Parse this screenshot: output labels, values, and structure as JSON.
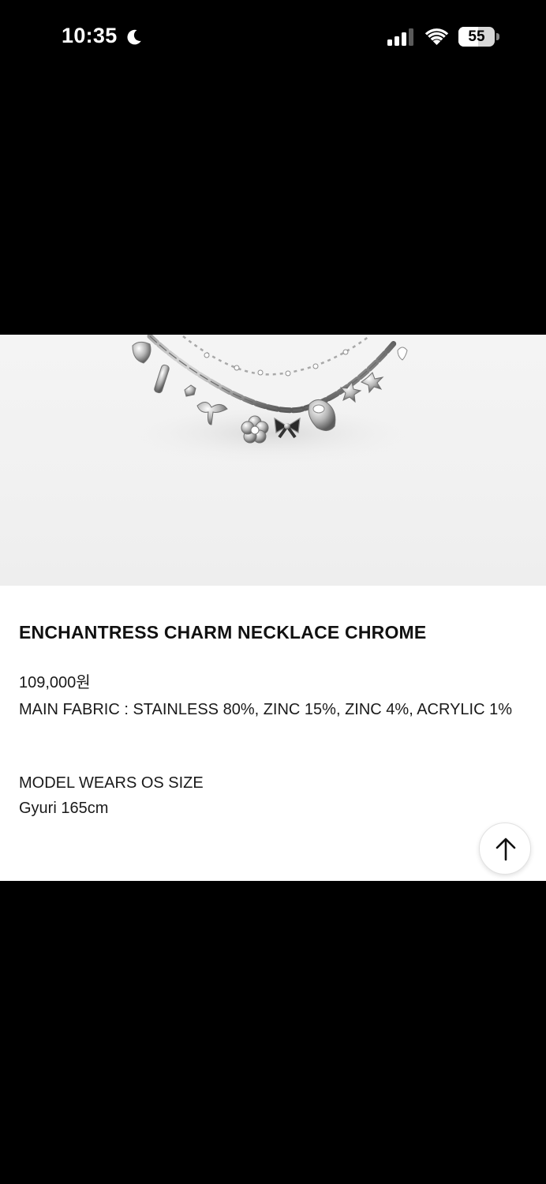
{
  "status_bar": {
    "time": "10:35",
    "battery_level": "55",
    "battery_fraction": 0.55,
    "icons": [
      "moon-icon",
      "cellular-signal-icon",
      "wifi-icon",
      "battery-icon"
    ]
  },
  "product": {
    "image_alt_icon": "necklace-image",
    "name": "ENCHANTRESS CHARM NECKLACE CHROME",
    "price": "109,000원",
    "fabric": "MAIN FABRIC : STAINLESS 80%, ZINC 15%, ZINC 4%, ACRYLIC 1%",
    "model_wears": "MODEL WEARS OS SIZE",
    "model_size": "Gyuri 165cm"
  },
  "scroll_top": {
    "icon": "arrow-up-icon"
  },
  "colors": {
    "background": "#000000",
    "panel": "#ffffff",
    "text": "#111111",
    "image_bg": "#f2f2f2",
    "chrome": "#9a9a9a"
  }
}
